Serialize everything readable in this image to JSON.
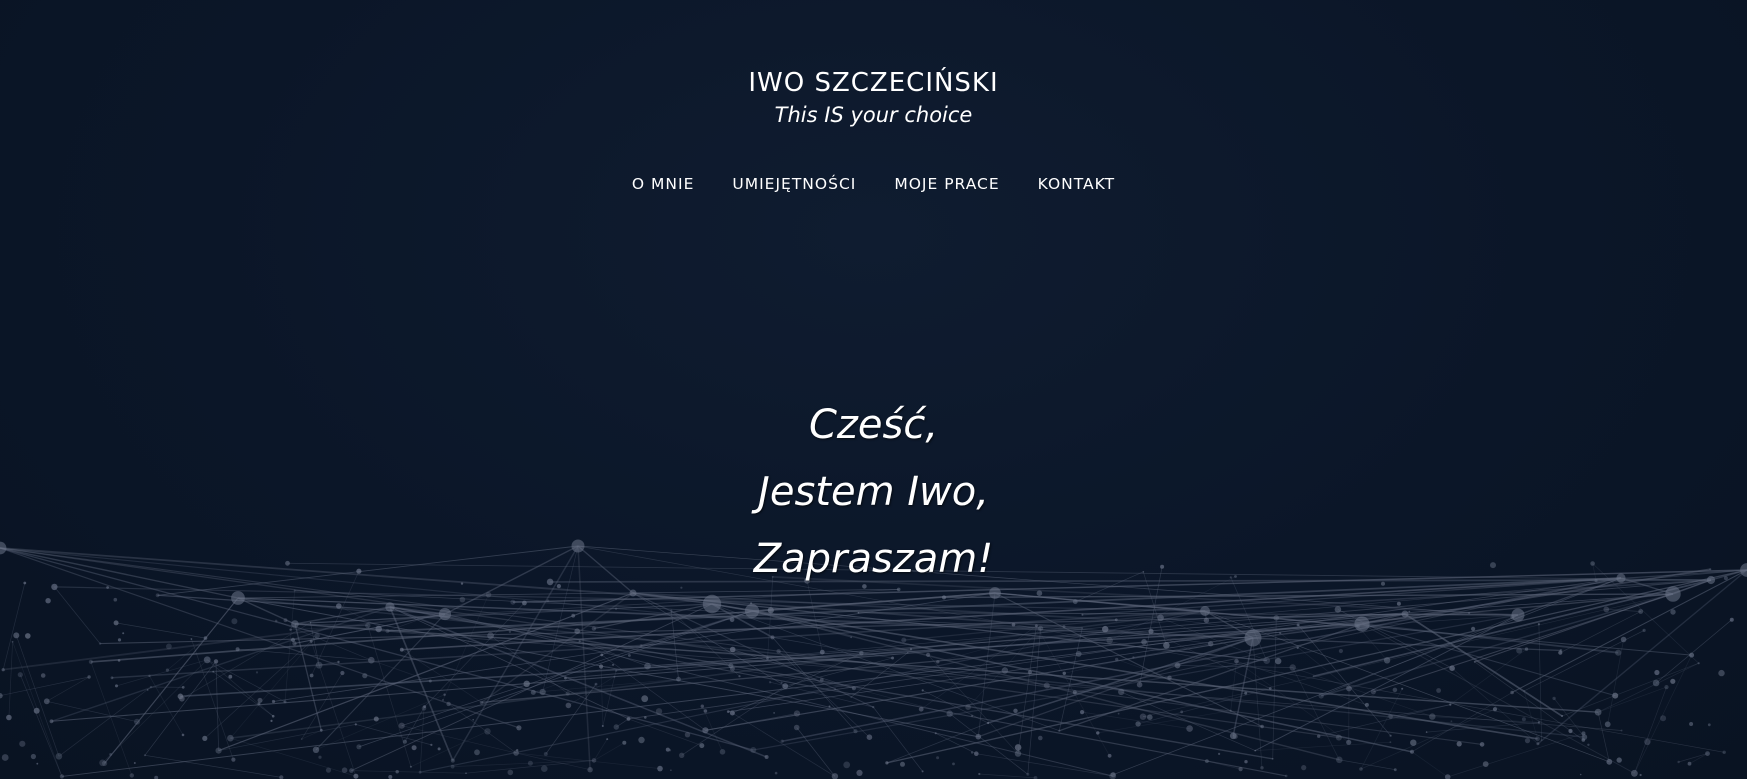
{
  "header": {
    "site_title": "IWO SZCZECIŃSKI",
    "tagline": "This IS your choice"
  },
  "nav": {
    "items": [
      {
        "label": "O MNIE"
      },
      {
        "label": "UMIEJĘTNOŚCI"
      },
      {
        "label": "MOJE PRACE"
      },
      {
        "label": "KONTAKT"
      }
    ]
  },
  "hero": {
    "lines": [
      "Cześć,",
      "Jestem Iwo,",
      "Zapraszam!"
    ]
  },
  "colors": {
    "background": "#0b1628",
    "text": "#ffffff",
    "network_lines": "#5b6478",
    "network_nodes": "#6b7488"
  },
  "icons": {
    "background_graphic": "network-mesh-graphic"
  }
}
